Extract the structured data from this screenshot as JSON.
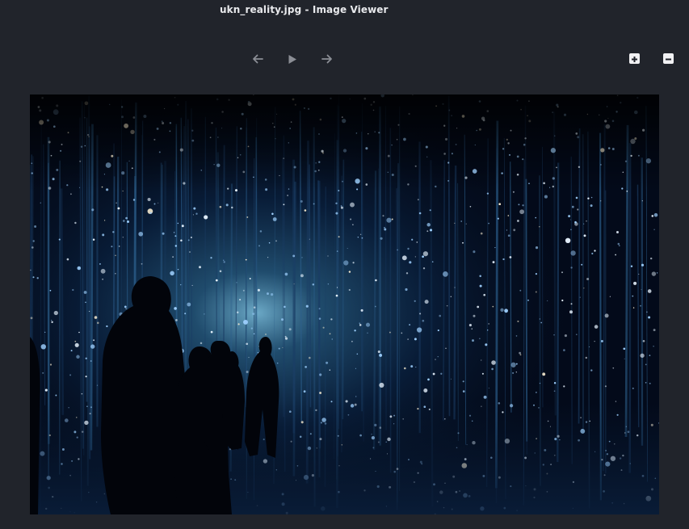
{
  "window": {
    "title": "ukn_reality.jpg - Image Viewer"
  },
  "toolbar": {
    "previous_icon": "arrow-left-icon",
    "play_icon": "play-icon",
    "next_icon": "arrow-right-icon",
    "zoom_in_icon": "plus-square-icon",
    "zoom_out_icon": "minus-square-icon"
  },
  "colors": {
    "background": "#21242b",
    "title_text": "#e8e9ec",
    "nav_icon": "#8b8e95",
    "zoom_icon_bg": "#f1f1f3"
  },
  "image": {
    "filename": "ukn_reality.jpg"
  }
}
